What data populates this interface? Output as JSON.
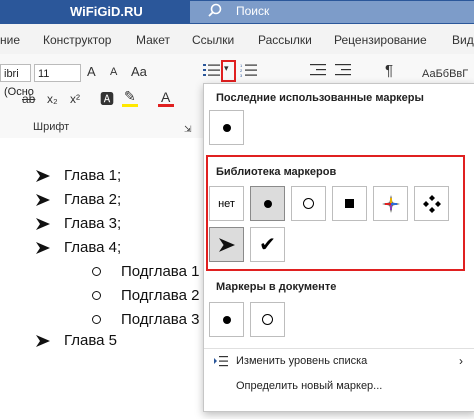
{
  "titlebar": {
    "title": "WiFiGiD.RU",
    "search_label": "Поиск"
  },
  "tabs": [
    "ние",
    "Конструктор",
    "Макет",
    "Ссылки",
    "Рассылки",
    "Рецензирование",
    "Вид"
  ],
  "ribbon": {
    "font_name": "ibri (Осно",
    "font_size": "11",
    "font_group_label": "Шрифт",
    "style_preview": "АаБбВвГ",
    "grow_font": "A",
    "shrink_font": "A",
    "case_btn": "Aa",
    "strike": "ab",
    "subscript": "x₂",
    "superscript": "x²",
    "font_color": "A",
    "paragraph_mark": "¶"
  },
  "document": {
    "items": [
      {
        "level": 1,
        "text": "Глава 1;"
      },
      {
        "level": 1,
        "text": "Глава 2;"
      },
      {
        "level": 1,
        "text": "Глава 3;"
      },
      {
        "level": 1,
        "text": "Глава 4;"
      },
      {
        "level": 2,
        "text": "Подглава 1"
      },
      {
        "level": 2,
        "text": "Подглава 2"
      },
      {
        "level": 2,
        "text": "Подглава 3"
      },
      {
        "level": 1,
        "text": "Глава 5"
      }
    ]
  },
  "panel": {
    "recent_title": "Последние использованные маркеры",
    "library_title": "Библиотека маркеров",
    "none_label": "нет",
    "document_title": "Маркеры в документе",
    "change_level": "Изменить уровень списка",
    "define_new": "Определить новый маркер..."
  },
  "colors": {
    "accent": "#2b579a",
    "highlight": "#e02020",
    "selected_cell": "#dcdcdc"
  }
}
